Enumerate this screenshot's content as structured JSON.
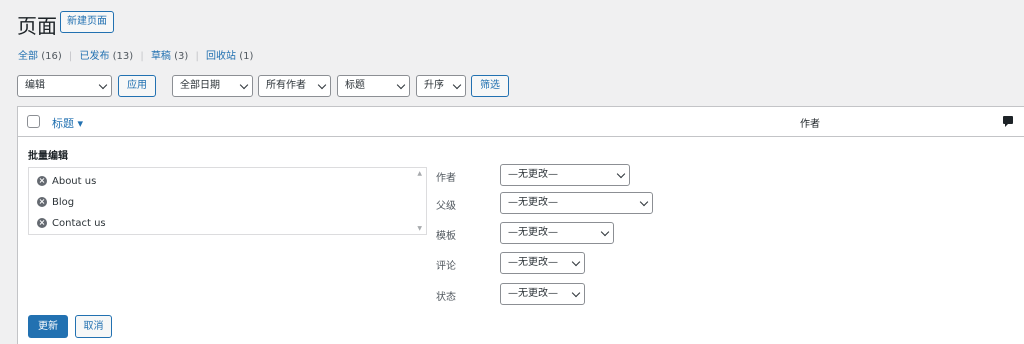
{
  "header": {
    "title": "页面",
    "add_new": "新建页面"
  },
  "views": [
    {
      "label": "全部",
      "count": "(16)"
    },
    {
      "label": "已发布",
      "count": "(13)"
    },
    {
      "label": "草稿",
      "count": "(3)"
    },
    {
      "label": "回收站",
      "count": "(1)"
    }
  ],
  "filters": {
    "bulk_action": "编辑",
    "apply": "应用",
    "date": "全部日期",
    "author": "所有作者",
    "orderby": "标题",
    "order": "升序",
    "filter_button": "筛选"
  },
  "table": {
    "col_title": "标题 ▾",
    "col_author": "作者"
  },
  "bulk_edit": {
    "heading": "批量编辑",
    "items": [
      "About us",
      "Blog",
      "Contact us"
    ],
    "fields": [
      {
        "label": "作者",
        "value": "—无更改—"
      },
      {
        "label": "父级",
        "value": "—无更改—"
      },
      {
        "label": "模板",
        "value": "—无更改—"
      },
      {
        "label": "评论",
        "value": "—无更改—"
      },
      {
        "label": "状态",
        "value": "—无更改—"
      }
    ],
    "update": "更新",
    "cancel": "取消"
  },
  "colors": {
    "accent": "#2271b1",
    "background": "#f0f0f1",
    "border": "#c3c4c7"
  },
  "icons": {
    "remove": "remove-circle-icon",
    "comment": "comment-bubble-icon",
    "dropdown": "chevron-down-icon"
  }
}
